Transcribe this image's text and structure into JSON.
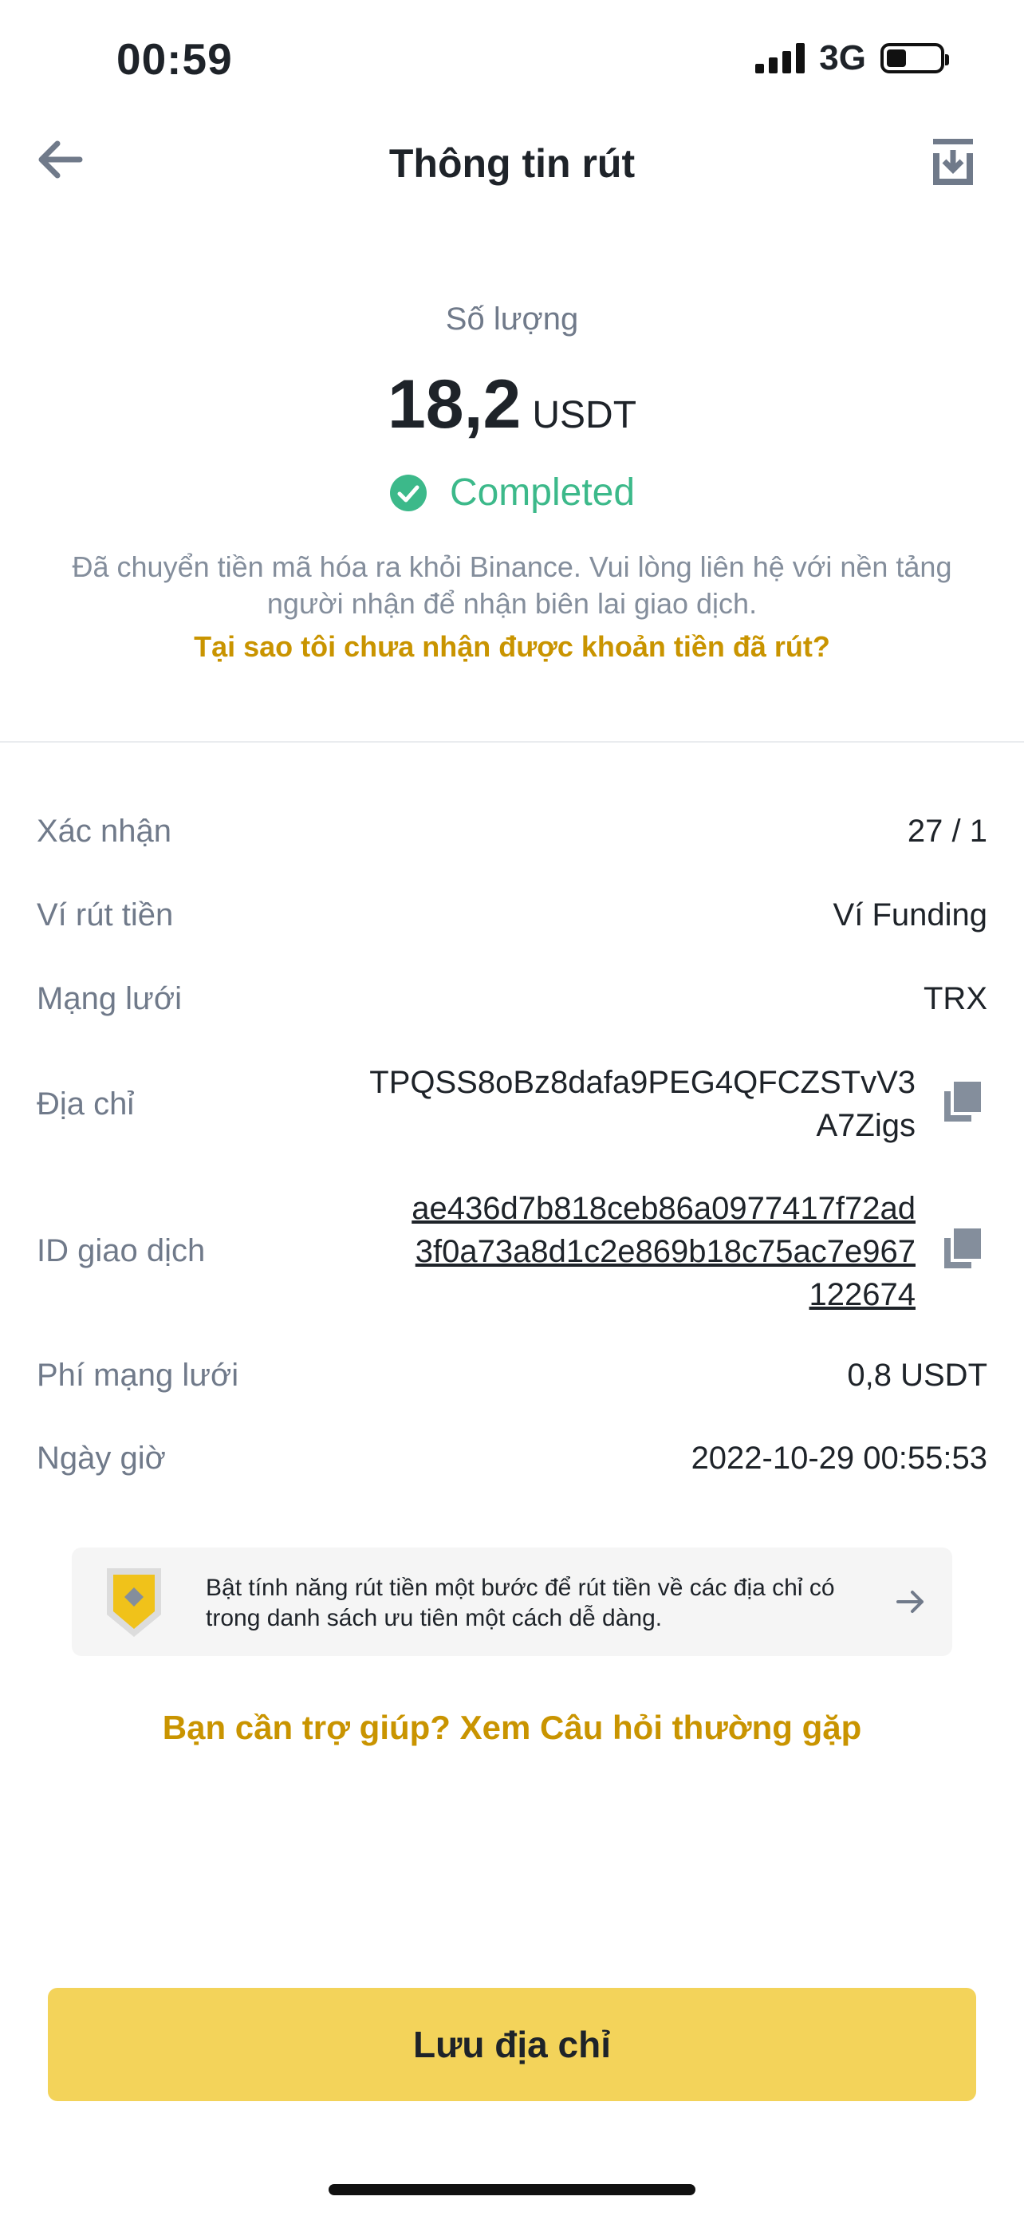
{
  "status_bar": {
    "time": "00:59",
    "network": "3G",
    "battery_level": 0.38
  },
  "header": {
    "title": "Thông tin rút",
    "back_icon": "arrow-left-icon",
    "download_icon": "download-icon"
  },
  "amount": {
    "label": "Số lượng",
    "value": "18,2",
    "unit": "USDT",
    "status": "Completed",
    "status_color": "#3cb98a",
    "info": "Đã chuyển tiền mã hóa ra khỏi Binance. Vui lòng liên hệ với nền tảng người nhận để nhận biên lai giao dịch.",
    "why_link": "Tại sao tôi chưa nhận được khoản tiền đã rút?"
  },
  "details": {
    "confirm": {
      "label": "Xác nhận",
      "value": "27 / 1"
    },
    "wallet": {
      "label": "Ví rút tiền",
      "value": "Ví Funding"
    },
    "network": {
      "label": "Mạng lưới",
      "value": "TRX"
    },
    "address": {
      "label": "Địa chỉ",
      "line1": "TPQSS8oBz8dafa9PEG4QFCZSTvV3",
      "line2": "A7Zigs"
    },
    "txid": {
      "label": "ID giao dịch",
      "line1": "ae436d7b818ceb86a0977417f72ad",
      "line2": "3f0a73a8d1c2e869b18c75ac7e967",
      "line3": "122674"
    },
    "fee": {
      "label": "Phí mạng lưới",
      "value": "0,8 USDT"
    },
    "datetime": {
      "label": "Ngày giờ",
      "value": "2022-10-29 00:55:53"
    }
  },
  "banner": {
    "line1": "Bật tính năng rút tiền một bước để rút tiền về các địa chỉ có",
    "line2": "trong danh sách ưu tiên một cách dễ dàng."
  },
  "help_link": "Bạn cần trợ giúp? Xem Câu hỏi thường gặp",
  "save_button": "Lưu địa chỉ",
  "colors": {
    "accent": "#c99400",
    "button": "#f3d35a",
    "success": "#3cb98a"
  }
}
